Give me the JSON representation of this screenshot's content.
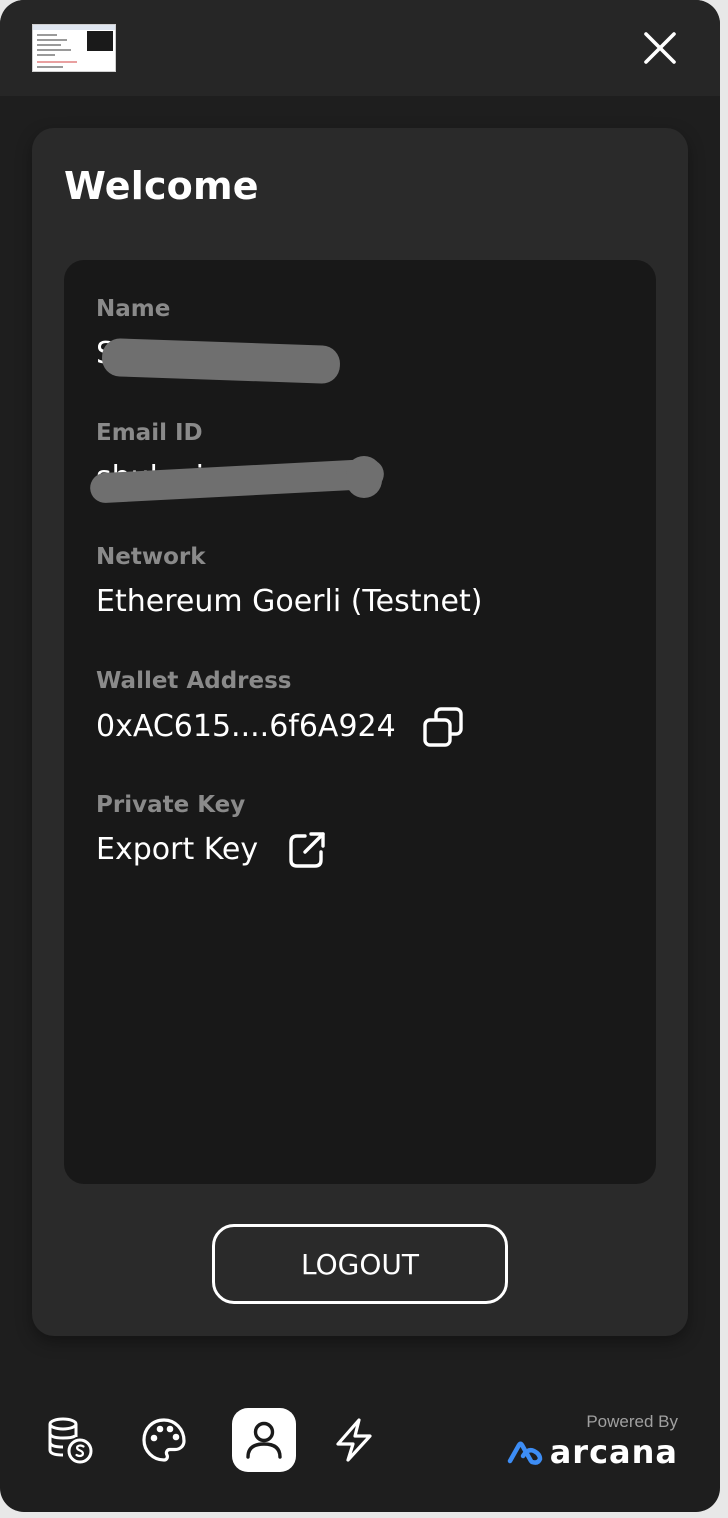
{
  "header": {
    "close_icon": "close-icon",
    "thumbnail": "site-thumbnail"
  },
  "card": {
    "title": "Welcome",
    "fields": [
      {
        "label": "Name",
        "value": "Sh"
      },
      {
        "label": "Email ID",
        "value": "shuk...io"
      },
      {
        "label": "Network",
        "value": "Ethereum Goerli (Testnet)"
      },
      {
        "label": "Wallet Address",
        "value": "0xAC615....6f6A924",
        "action_icon": "copy-icon"
      },
      {
        "label": "Private Key",
        "value": "Export Key",
        "action_icon": "external-link-icon"
      }
    ],
    "logout_label": "LOGOUT"
  },
  "nav": {
    "items": [
      {
        "name": "tokens",
        "icon": "coins-icon"
      },
      {
        "name": "theme",
        "icon": "palette-icon"
      },
      {
        "name": "profile",
        "icon": "user-icon",
        "active": true
      },
      {
        "name": "activity",
        "icon": "lightning-icon"
      }
    ],
    "powered_by": "Powered By",
    "brand": "arcana"
  },
  "colors": {
    "background": "#1e1e1e",
    "card": "#2a2a2a",
    "info_panel": "#181818",
    "label": "#8a8a8a",
    "text": "#ffffff",
    "brand_blue": "#3d8df5"
  }
}
